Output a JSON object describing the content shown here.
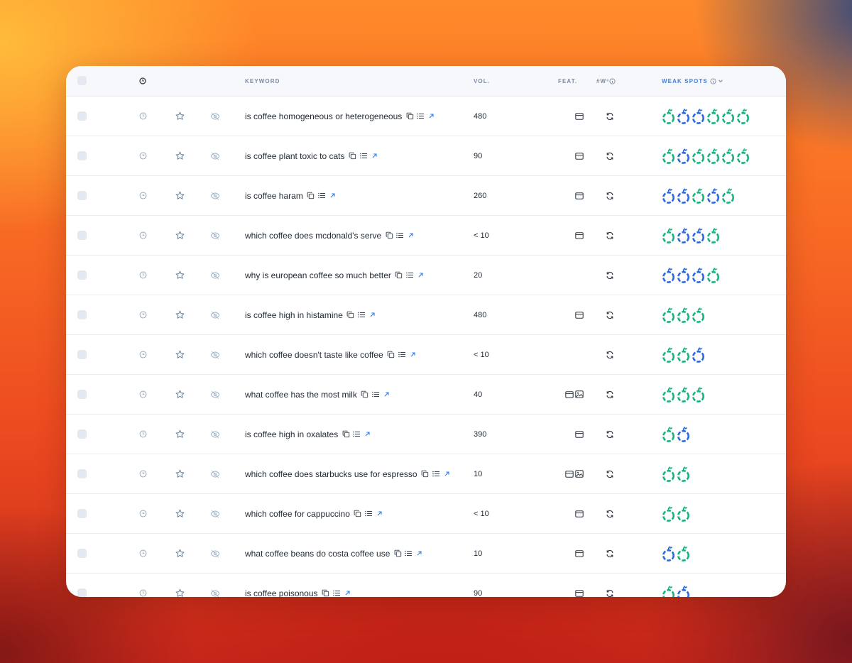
{
  "header": {
    "keyword_label": "KEYWORD",
    "vol_label": "VOL.",
    "feat_label": "FEAT.",
    "w3_label": "#W³",
    "weak_spots_label": "WEAK SPOTS"
  },
  "colors": {
    "green": "#17b27f",
    "blue": "#2f68de",
    "link_blue": "#2c7be5",
    "icon_gray": "#8a97aa"
  },
  "rows": [
    {
      "keyword": "is coffee homogeneous or heterogeneous",
      "vol": "480",
      "feat": [
        "card"
      ],
      "weak_spots": [
        "green",
        "blue",
        "blue",
        "green",
        "green",
        "green"
      ]
    },
    {
      "keyword": "is coffee plant toxic to cats",
      "vol": "90",
      "feat": [
        "card"
      ],
      "weak_spots": [
        "green",
        "blue",
        "green",
        "green",
        "green",
        "green"
      ]
    },
    {
      "keyword": "is coffee haram",
      "vol": "260",
      "feat": [
        "card"
      ],
      "weak_spots": [
        "blue",
        "blue",
        "green",
        "blue",
        "green"
      ]
    },
    {
      "keyword": "which coffee does mcdonald's serve",
      "vol": "< 10",
      "feat": [
        "card"
      ],
      "weak_spots": [
        "green",
        "blue",
        "blue",
        "green"
      ]
    },
    {
      "keyword": "why is european coffee so much better",
      "vol": "20",
      "feat": [],
      "weak_spots": [
        "blue",
        "blue",
        "blue",
        "green"
      ]
    },
    {
      "keyword": "is coffee high in histamine",
      "vol": "480",
      "feat": [
        "card"
      ],
      "weak_spots": [
        "green",
        "green",
        "green"
      ]
    },
    {
      "keyword": "which coffee doesn't taste like coffee",
      "vol": "< 10",
      "feat": [],
      "weak_spots": [
        "green",
        "green",
        "blue"
      ]
    },
    {
      "keyword": "what coffee has the most milk",
      "vol": "40",
      "feat": [
        "card",
        "image"
      ],
      "weak_spots": [
        "green",
        "green",
        "green"
      ]
    },
    {
      "keyword": "is coffee high in oxalates",
      "vol": "390",
      "feat": [
        "card"
      ],
      "weak_spots": [
        "green",
        "blue"
      ]
    },
    {
      "keyword": "which coffee does starbucks use for espresso",
      "vol": "10",
      "feat": [
        "card",
        "image"
      ],
      "weak_spots": [
        "green",
        "green"
      ]
    },
    {
      "keyword": "which coffee for cappuccino",
      "vol": "< 10",
      "feat": [
        "card"
      ],
      "weak_spots": [
        "green",
        "green"
      ]
    },
    {
      "keyword": "what coffee beans do costa coffee use",
      "vol": "10",
      "feat": [
        "card"
      ],
      "weak_spots": [
        "blue",
        "green"
      ]
    },
    {
      "keyword": "is coffee poisonous",
      "vol": "90",
      "feat": [
        "card"
      ],
      "weak_spots": [
        "green",
        "blue"
      ]
    }
  ]
}
